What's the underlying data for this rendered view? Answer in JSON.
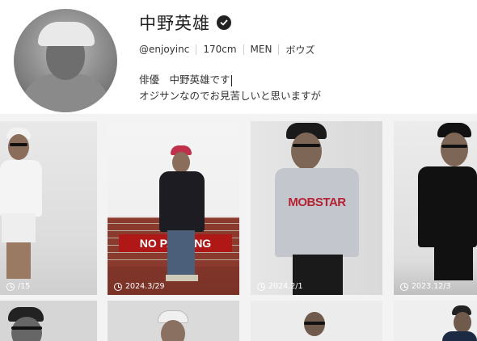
{
  "profile": {
    "name": "中野英雄",
    "handle": "@enjoyinc",
    "height": "170cm",
    "gender": "MEN",
    "hair": "ボウズ",
    "bio_line1": "俳優　中野英雄です",
    "bio_line2": "オジサンなのでお見苦しいと思いますが"
  },
  "posts": [
    {
      "date": "/15"
    },
    {
      "date": "2024.3/29",
      "sign_text": "NO PARKING"
    },
    {
      "date": "2024.2/1",
      "shirt_text": "MOBSTAR"
    },
    {
      "date": "2023.12/3"
    }
  ],
  "icons": {
    "verified": "verified-check-icon",
    "date": "clock-icon"
  },
  "colors": {
    "accent": "#222222",
    "sign_red": "#b01818",
    "brick": "#8b3a2e"
  }
}
